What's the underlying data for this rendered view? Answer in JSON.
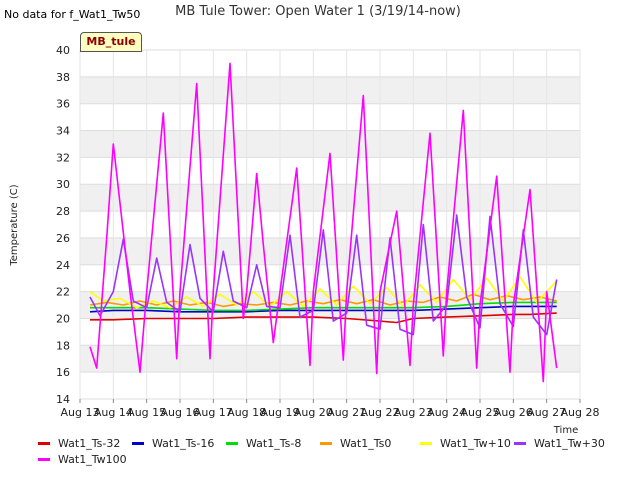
{
  "nodata_text": "No data for f_Wat1_Tw50",
  "badge_text": "MB_tule",
  "chart_data": {
    "type": "line",
    "title": "MB Tule Tower: Open Water 1 (3/19/14-now)",
    "xlabel": "Time",
    "ylabel": "Temperature (C)",
    "ylim": [
      14,
      40
    ],
    "yticks": [
      14,
      16,
      18,
      20,
      22,
      24,
      26,
      28,
      30,
      32,
      34,
      36,
      38,
      40
    ],
    "xlim": [
      13,
      28
    ],
    "xticks": [
      13,
      14,
      15,
      16,
      17,
      18,
      19,
      20,
      21,
      22,
      23,
      24,
      25,
      26,
      27,
      28
    ],
    "xtick_labels": [
      "Aug 13",
      "Aug 14",
      "Aug 15",
      "Aug 16",
      "Aug 17",
      "Aug 18",
      "Aug 19",
      "Aug 20",
      "Aug 21",
      "Aug 22",
      "Aug 23",
      "Aug 24",
      "Aug 25",
      "Aug 26",
      "Aug 27",
      "Aug 28"
    ],
    "grid": true,
    "legend_position": "bottom",
    "series": [
      {
        "name": "Wat1_Ts-32",
        "color": "#e00000",
        "x": [
          13.3,
          14,
          15,
          16,
          17,
          18,
          19,
          20,
          21,
          22,
          22.5,
          23,
          24,
          25,
          26,
          26.5,
          27.3
        ],
        "y": [
          19.9,
          19.9,
          20.0,
          20.0,
          20.0,
          20.1,
          20.1,
          20.1,
          20.0,
          19.8,
          19.7,
          20.0,
          20.1,
          20.2,
          20.3,
          20.3,
          20.4
        ]
      },
      {
        "name": "Wat1_Ts-16",
        "color": "#0000cc",
        "x": [
          13.3,
          14,
          15,
          16,
          17,
          18,
          19,
          20,
          21,
          22,
          23,
          24,
          25,
          26,
          27.3
        ],
        "y": [
          20.5,
          20.6,
          20.6,
          20.5,
          20.5,
          20.5,
          20.6,
          20.6,
          20.6,
          20.6,
          20.6,
          20.7,
          20.8,
          20.9,
          20.9
        ]
      },
      {
        "name": "Wat1_Ts-8",
        "color": "#00dd00",
        "x": [
          13.3,
          14,
          15,
          16,
          17,
          18,
          19,
          20,
          21,
          22,
          23,
          24,
          25,
          26,
          27.3
        ],
        "y": [
          20.8,
          20.8,
          20.8,
          20.7,
          20.6,
          20.6,
          20.7,
          20.8,
          20.8,
          20.8,
          20.8,
          20.9,
          21.1,
          21.2,
          21.2
        ]
      },
      {
        "name": "Wat1_Ts0",
        "color": "#ff9900",
        "x": [
          13.3,
          13.8,
          14.3,
          14.8,
          15.3,
          15.8,
          16.3,
          16.8,
          17.3,
          17.8,
          18.3,
          18.8,
          19.3,
          19.8,
          20.3,
          20.8,
          21.3,
          21.8,
          22.3,
          22.8,
          23.3,
          23.8,
          24.3,
          24.8,
          25.3,
          25.8,
          26.3,
          26.8,
          27.3
        ],
        "y": [
          21.0,
          21.2,
          21.0,
          21.3,
          21.0,
          21.3,
          21.0,
          21.2,
          20.9,
          21.1,
          21.0,
          21.2,
          21.0,
          21.3,
          21.1,
          21.4,
          21.1,
          21.4,
          21.0,
          21.3,
          21.2,
          21.6,
          21.3,
          21.8,
          21.4,
          21.7,
          21.4,
          21.6,
          21.3
        ]
      },
      {
        "name": "Wat1_Tw+10",
        "color": "#ffff00",
        "x": [
          13.3,
          13.7,
          14.2,
          14.7,
          15.2,
          15.7,
          16.2,
          16.7,
          17.2,
          17.7,
          18.2,
          18.7,
          19.2,
          19.7,
          20.2,
          20.7,
          21.2,
          21.7,
          22.2,
          22.7,
          23.2,
          23.7,
          24.2,
          24.7,
          25.2,
          25.7,
          26.2,
          26.7,
          27.3
        ],
        "y": [
          22.0,
          21.3,
          21.5,
          20.8,
          21.3,
          20.8,
          21.6,
          20.9,
          21.8,
          21.0,
          22.0,
          20.9,
          22.0,
          20.9,
          22.2,
          21.0,
          22.4,
          21.1,
          22.3,
          20.9,
          22.5,
          21.2,
          22.9,
          21.4,
          23.0,
          21.3,
          23.1,
          21.2,
          22.8
        ]
      },
      {
        "name": "Wat1_Tw+30",
        "color": "#9933ff",
        "x": [
          13.3,
          13.6,
          14.0,
          14.3,
          14.6,
          15.0,
          15.3,
          15.6,
          16.0,
          16.3,
          16.6,
          17.0,
          17.3,
          17.6,
          18.0,
          18.3,
          18.6,
          19.0,
          19.3,
          19.6,
          20.0,
          20.3,
          20.6,
          21.0,
          21.3,
          21.6,
          22.0,
          22.3,
          22.6,
          23.0,
          23.3,
          23.6,
          24.0,
          24.3,
          24.6,
          25.0,
          25.3,
          25.6,
          26.0,
          26.3,
          26.6,
          27.0,
          27.3
        ],
        "y": [
          21.6,
          20.2,
          22.0,
          25.9,
          21.3,
          20.8,
          24.5,
          21.2,
          20.5,
          25.5,
          21.5,
          20.5,
          25.0,
          21.3,
          20.8,
          24.0,
          20.9,
          20.8,
          26.2,
          20.1,
          20.6,
          26.6,
          19.8,
          20.4,
          26.2,
          19.5,
          19.2,
          26.0,
          19.2,
          18.8,
          27.0,
          19.8,
          21.0,
          27.7,
          21.6,
          19.3,
          27.6,
          21.1,
          19.4,
          26.6,
          20.1,
          18.8,
          22.9
        ]
      },
      {
        "name": "Wat1_Tw100",
        "color": "#ff00ff",
        "x": [
          13.3,
          13.5,
          13.8,
          14.0,
          14.5,
          14.8,
          15.0,
          15.5,
          15.9,
          16.0,
          16.5,
          16.9,
          17.0,
          17.5,
          17.9,
          18.0,
          18.3,
          18.5,
          18.8,
          19.0,
          19.5,
          19.9,
          20.0,
          20.5,
          20.9,
          21.0,
          21.5,
          21.9,
          22.0,
          22.5,
          22.9,
          23.0,
          23.5,
          23.9,
          24.0,
          24.5,
          24.9,
          25.0,
          25.5,
          25.9,
          26.0,
          26.5,
          26.9,
          27.0,
          27.3
        ],
        "y": [
          17.9,
          16.3,
          26.0,
          33.0,
          22.0,
          16.0,
          22.0,
          35.3,
          17.0,
          22.0,
          37.5,
          17.0,
          22.0,
          39.0,
          20.0,
          22.0,
          30.8,
          25.5,
          18.2,
          22.0,
          31.2,
          16.5,
          22.0,
          32.3,
          16.9,
          22.0,
          36.6,
          15.9,
          22.0,
          28.0,
          16.5,
          21.0,
          33.8,
          17.2,
          22.0,
          35.5,
          16.3,
          21.0,
          30.6,
          16.0,
          21.0,
          29.6,
          15.3,
          22.0,
          16.3
        ]
      }
    ]
  }
}
